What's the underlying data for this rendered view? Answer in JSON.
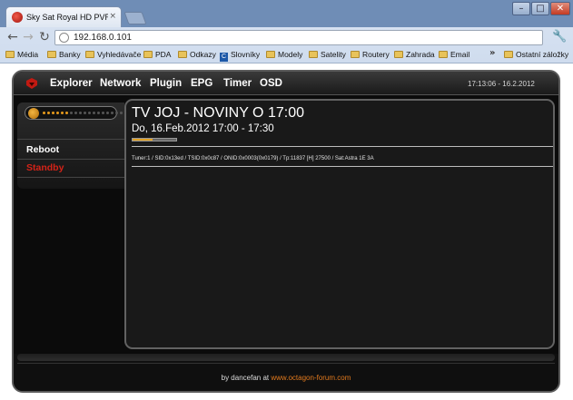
{
  "browser": {
    "tab_title": "Sky Sat Royal HD PVR Read",
    "tab_close": "×",
    "window_min": "–",
    "window_max": "□",
    "window_close": "✕",
    "back_icon": "arrow-left",
    "forward_icon": "arrow-right",
    "reload_icon": "reload",
    "address": "192.168.0.101",
    "menu_icon": "wrench"
  },
  "bookmarks": {
    "items": [
      "Média",
      "Banky",
      "Vyhledávače",
      "PDA",
      "Odkazy",
      "Slovníky",
      "Modely",
      "Satelity",
      "Routery",
      "Zahrada",
      "Email"
    ],
    "overflow": "»",
    "other": "Ostatní záložky"
  },
  "topnav": {
    "items": [
      "Explorer",
      "Network",
      "Plugin",
      "EPG",
      "Timer",
      "OSD"
    ],
    "clock": "17:13:06 - 16.2.2012"
  },
  "sidebar": {
    "volume_level": 0.33,
    "items": [
      {
        "label": "Reboot",
        "color": "#ffffff"
      },
      {
        "label": "Standby",
        "color": "#d42318"
      }
    ]
  },
  "program": {
    "title": "TV JOJ - NOVINY O 17:00",
    "time": "Do, 16.Feb.2012 17:00 - 17:30",
    "progress": 0.45,
    "tuner_info": "Tuner:1 / SID:0x13ed / TSID:0x0c87 / ONID:0x0003(0x0179) / Tp:11837 [H] 27500 / Sat:Astra 1E 3A"
  },
  "footer": {
    "prefix": "by dancefan at ",
    "link": "www.octagon-forum.com"
  },
  "colors": {
    "accent": "#e79b1c",
    "link": "#e27a1e",
    "standby": "#d42318"
  }
}
